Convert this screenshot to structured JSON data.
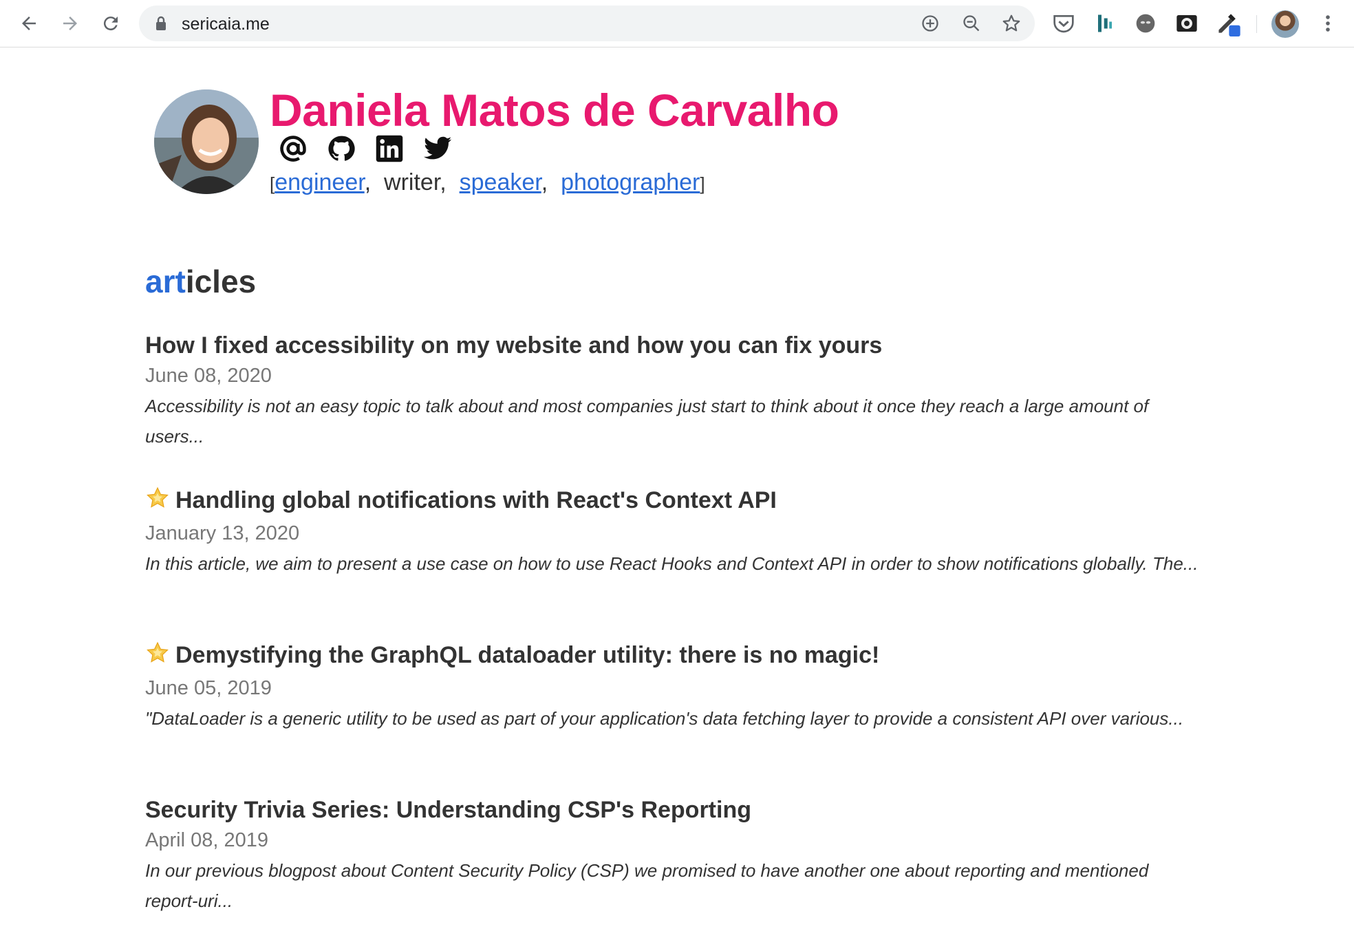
{
  "browser": {
    "url": "sericaia.me",
    "nav_icons": [
      "back-arrow-icon",
      "forward-arrow-icon",
      "reload-icon"
    ],
    "omnibox_icons": [
      "add-circle-icon",
      "zoom-out-icon",
      "bookmark-star-icon"
    ],
    "extension_icons": [
      "pocket-icon",
      "extension-bars-icon",
      "extension-cat-icon",
      "extension-eye-icon",
      "eyedropper-icon"
    ]
  },
  "profile": {
    "name": "Daniela Matos de Carvalho",
    "social_icons": [
      "at-sign-icon",
      "github-icon",
      "linkedin-icon",
      "twitter-icon"
    ],
    "roles_open": "[",
    "roles_close": "]",
    "roles": [
      {
        "label": "engineer",
        "link": true
      },
      {
        "label": "writer",
        "link": false
      },
      {
        "label": "speaker",
        "link": true
      },
      {
        "label": "photographer",
        "link": true
      }
    ],
    "name_color": "#e8196e",
    "link_color": "#2a6bd6"
  },
  "articles_section": {
    "title_accent": "art",
    "title_rest": "icles"
  },
  "articles": [
    {
      "title": "How I fixed accessibility on my website and how you can fix yours",
      "featured": false,
      "date": "June 08, 2020",
      "excerpt": "Accessibility is not an easy topic to talk about and most companies just start to think about it once they reach a large amount of users..."
    },
    {
      "title": "Handling global notifications with React's Context API",
      "featured": true,
      "date": "January 13, 2020",
      "excerpt": "In this article, we aim to present a use case on how to use React Hooks and Context API in order to show notifications globally. The..."
    },
    {
      "title": "Demystifying the GraphQL dataloader utility: there is no magic!",
      "featured": true,
      "date": "June 05, 2019",
      "excerpt": "\"DataLoader is a generic utility to be used as part of your application's data fetching layer to provide a consistent API over various..."
    },
    {
      "title": "Security Trivia Series: Understanding CSP's Reporting",
      "featured": false,
      "date": "April 08, 2019",
      "excerpt": "In our previous blogpost about Content Security Policy (CSP) we promised to have another one about reporting and mentioned report-uri..."
    }
  ]
}
